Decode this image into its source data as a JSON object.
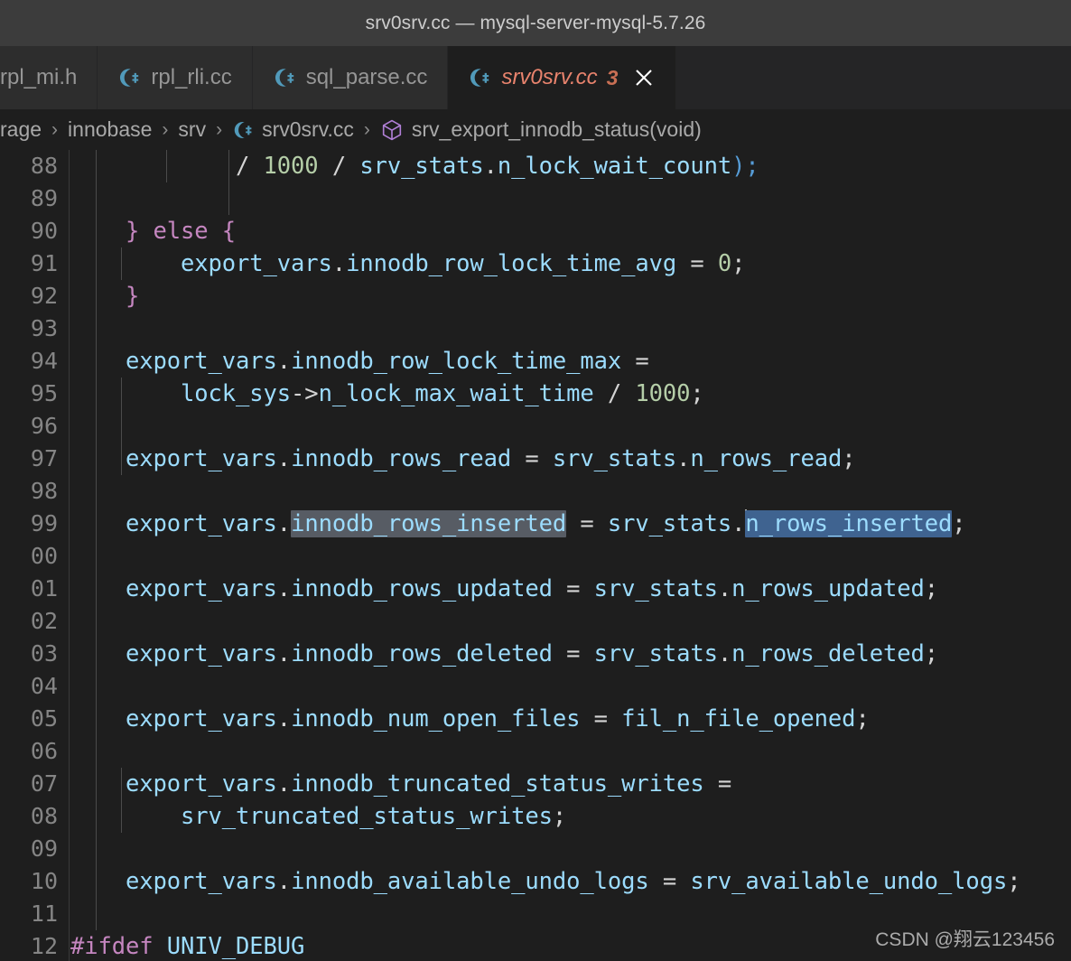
{
  "window": {
    "title": "srv0srv.cc — mysql-server-mysql-5.7.26"
  },
  "tabs": [
    {
      "label": "rpl_mi.h",
      "icon": "cpp-file-icon",
      "active": false,
      "clipped": true,
      "badge": "",
      "has_icon": false
    },
    {
      "label": "rpl_rli.cc",
      "icon": "cpp-file-icon",
      "active": false,
      "clipped": false,
      "badge": "",
      "has_icon": true
    },
    {
      "label": "sql_parse.cc",
      "icon": "cpp-file-icon",
      "active": false,
      "clipped": false,
      "badge": "",
      "has_icon": true
    },
    {
      "label": "srv0srv.cc",
      "icon": "cpp-file-icon",
      "active": true,
      "clipped": false,
      "badge": "3",
      "has_icon": true
    }
  ],
  "breadcrumb": {
    "items": [
      {
        "label": "rage",
        "icon": ""
      },
      {
        "label": "innobase",
        "icon": ""
      },
      {
        "label": "srv",
        "icon": ""
      },
      {
        "label": "srv0srv.cc",
        "icon": "cpp-file-icon"
      },
      {
        "label": "srv_export_innodb_status(void)",
        "icon": "symbol-cube-icon"
      }
    ],
    "separator": "›"
  },
  "editor": {
    "language": "cpp",
    "first_visible_line_display": "88",
    "line_numbers": [
      "88",
      "89",
      "90",
      "91",
      "92",
      "93",
      "94",
      "95",
      "96",
      "97",
      "98",
      "99",
      "00",
      "01",
      "02",
      "03",
      "04",
      "05",
      "06",
      "07",
      "08",
      "09",
      "10",
      "11",
      "12"
    ],
    "lines": [
      {
        "n": "88",
        "text": "            / 1000 / srv_stats.n_lock_wait_count);"
      },
      {
        "n": "89",
        "text": ""
      },
      {
        "n": "90",
        "text": "    } else {"
      },
      {
        "n": "91",
        "text": "        export_vars.innodb_row_lock_time_avg = 0;"
      },
      {
        "n": "92",
        "text": "    }"
      },
      {
        "n": "93",
        "text": ""
      },
      {
        "n": "94",
        "text": "    export_vars.innodb_row_lock_time_max ="
      },
      {
        "n": "95",
        "text": "        lock_sys->n_lock_max_wait_time / 1000;"
      },
      {
        "n": "96",
        "text": ""
      },
      {
        "n": "97",
        "text": "    export_vars.innodb_rows_read = srv_stats.n_rows_read;"
      },
      {
        "n": "98",
        "text": ""
      },
      {
        "n": "99",
        "text": "    export_vars.innodb_rows_inserted = srv_stats.n_rows_inserted;"
      },
      {
        "n": "00",
        "text": ""
      },
      {
        "n": "01",
        "text": "    export_vars.innodb_rows_updated = srv_stats.n_rows_updated;"
      },
      {
        "n": "02",
        "text": ""
      },
      {
        "n": "03",
        "text": "    export_vars.innodb_rows_deleted = srv_stats.n_rows_deleted;"
      },
      {
        "n": "04",
        "text": ""
      },
      {
        "n": "05",
        "text": "    export_vars.innodb_num_open_files = fil_n_file_opened;"
      },
      {
        "n": "06",
        "text": ""
      },
      {
        "n": "07",
        "text": "    export_vars.innodb_truncated_status_writes ="
      },
      {
        "n": "08",
        "text": "        srv_truncated_status_writes;"
      },
      {
        "n": "09",
        "text": ""
      },
      {
        "n": "10",
        "text": "    export_vars.innodb_available_undo_logs = srv_available_undo_logs;"
      },
      {
        "n": "11",
        "text": ""
      },
      {
        "n": "12",
        "text": "#ifdef UNIV_DEBUG"
      }
    ],
    "selection": {
      "selected_text": "n_rows_inserted",
      "word_highlight_text": "innodb_rows_inserted",
      "line": "99"
    },
    "colors": {
      "background": "#1e1e1e",
      "variable": "#9cdcfe",
      "number": "#b5cea8",
      "keyword": "#c586c0",
      "punctuation": "#d4d4d4",
      "paren": "#569cd6",
      "line_number": "#858585",
      "selection": "#3f6390",
      "word_highlight": "#575c64",
      "indent_guide": "#4b4b4b",
      "titlebar": "#3c3c3c",
      "tab_inactive": "#2d2d2d",
      "tab_active_text": "#e8836d"
    }
  },
  "watermark": {
    "text": "CSDN @翔云123456"
  }
}
